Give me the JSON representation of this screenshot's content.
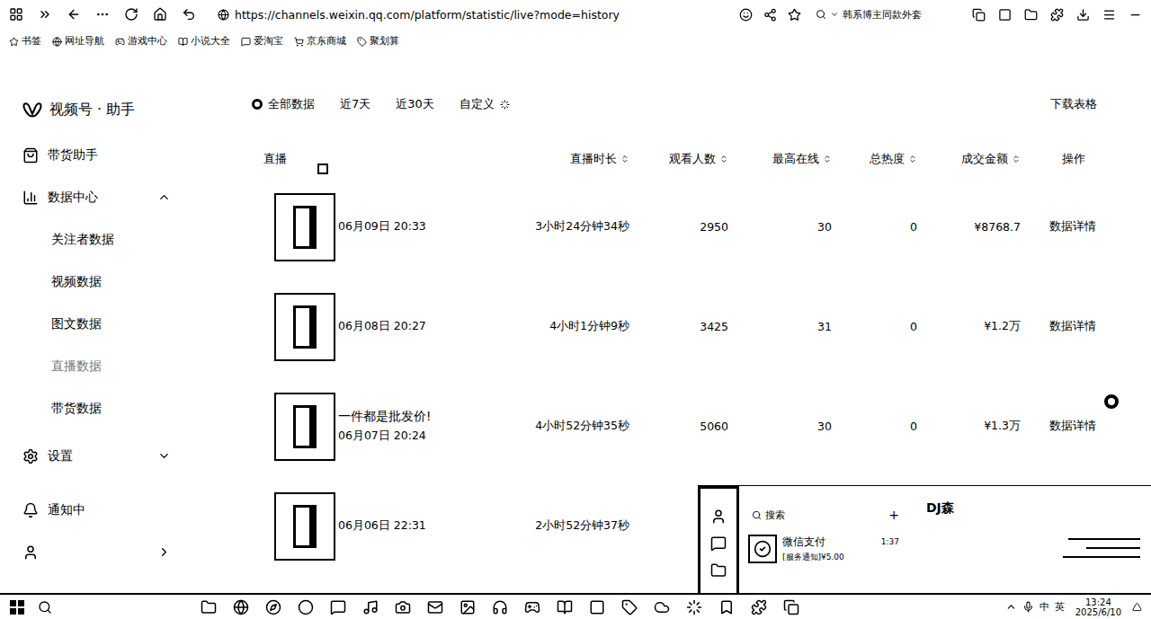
{
  "browser": {
    "url": "https://channels.weixin.qq.com/platform/statistic/live?mode=history",
    "search_query": "韩系博主同款外套",
    "bookmarks": [
      "书签",
      "网址导航",
      "游戏中心",
      "小说大全",
      "爱淘宝",
      "京东商城",
      "聚划算"
    ]
  },
  "sidebar": {
    "brand": "视频号 · 助手",
    "items": [
      {
        "label": "带货助手",
        "kind": "main",
        "selected": false
      },
      {
        "label": "数据中心",
        "kind": "toggle",
        "selected": false,
        "expanded": true
      },
      {
        "label": "关注者数据",
        "kind": "sub",
        "selected": false
      },
      {
        "label": "视频数据",
        "kind": "sub",
        "selected": false
      },
      {
        "label": "图文数据",
        "kind": "sub",
        "selected": false
      },
      {
        "label": "直播数据",
        "kind": "sub",
        "selected": true
      },
      {
        "label": "带货数据",
        "kind": "sub",
        "selected": false
      },
      {
        "label": "设置",
        "kind": "toggle",
        "selected": false,
        "expanded": false
      },
      {
        "label": "通知中",
        "kind": "main",
        "selected": false
      }
    ]
  },
  "filters": {
    "options": [
      {
        "label": "全部数据",
        "selected": true
      },
      {
        "label": "近7天",
        "selected": false
      },
      {
        "label": "近30天",
        "selected": false
      },
      {
        "label": "自定义",
        "selected": false
      }
    ],
    "download": "下载表格"
  },
  "table": {
    "columns": [
      {
        "label": "直播",
        "sortable": false
      },
      {
        "label": "直播时长",
        "sortable": true
      },
      {
        "label": "观看人数",
        "sortable": true
      },
      {
        "label": "最高在线",
        "sortable": true
      },
      {
        "label": "总热度",
        "sortable": true
      },
      {
        "label": "成交金额",
        "sortable": true
      },
      {
        "label": "操作",
        "sortable": false
      }
    ],
    "rows": [
      {
        "date": "06月09日 20:33",
        "duration": "3小时24分钟34秒",
        "viewers": "2950",
        "peak_online": "30",
        "heat": "0",
        "amount": "¥8768.7",
        "action": "数据详情"
      },
      {
        "date": "06月08日 20:27",
        "duration": "4小时1分钟9秒",
        "viewers": "3425",
        "peak_online": "31",
        "heat": "0",
        "amount": "¥1.2万",
        "action": "数据详情"
      },
      {
        "title": "一件都是批发价!",
        "date": "06月07日 20:24",
        "duration": "4小时52分钟35秒",
        "viewers": "5060",
        "peak_online": "30",
        "heat": "0",
        "amount": "¥1.3万",
        "action": "数据详情"
      },
      {
        "date": "06月06日 22:31",
        "duration": "2小时52分钟37秒"
      }
    ]
  },
  "wechat_popup": {
    "search_placeholder": "搜索",
    "add": "+",
    "chat_title": "DJ森",
    "chats": [
      {
        "name": "微信支付",
        "preview": "[服务通知]¥5.00",
        "time": "1:37"
      }
    ]
  },
  "taskbar": {
    "ime": [
      "中",
      "英"
    ],
    "time": "13:24",
    "date": "2025/6/10"
  }
}
